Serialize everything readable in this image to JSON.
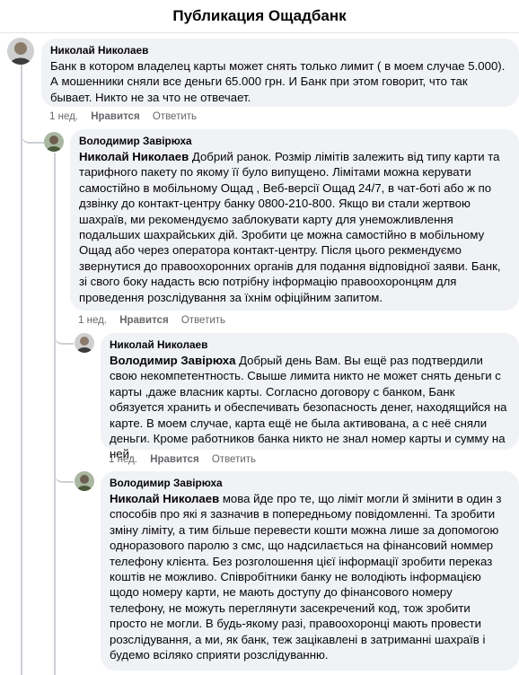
{
  "page": {
    "title": "Публикация Ощадбанк"
  },
  "comments": [
    {
      "author": "Николай Николаев",
      "mention": "",
      "text": "Банк в котором владелец карты может снять только лимит ( в моем случае 5.000). А мошенники сняли все деньги 65.000 грн. И Банк при этом говорит, что так бывает. Никто не за что не отвечает.",
      "time": "1 нед.",
      "like_label": "Нравится",
      "reply_label": "Ответить"
    },
    {
      "author": "Володимир Завірюха",
      "mention": "Николай Николаев",
      "text": " Добрий ранок. Розмір лімітів залежить від типу карти та тарифного пакету по якому її було випущено. Лімітами можна керувати самостійно в мобільному Ощад , Веб-версії Ощад 24/7, в чат-боті або ж по дзвінку до контакт-центру банку 0800-210-800. Якщо ви стали жертвою шахраїв, ми рекомендуємо заблокувати карту для унеможливлення подальших шахрайських дій. Зробити це можна самостійно в мобільному Ощад або через оператора контакт-центру. Після цього рекмендуємо звернутися до правоохоронних органів для подання відповідної заяви. Банк, зі свого боку надасть всю потрібну інформацію правоохоронцям для проведення розслідування за їхнім офіційним запитом.",
      "time": "1 нед.",
      "like_label": "Нравится",
      "reply_label": "Ответить"
    },
    {
      "author": "Николай Николаев",
      "mention": "Володимир Завірюха",
      "text": " Добрый день Вам. Вы ещё раз подтвердили свою некомпетентность. Свыше лимита никто не может снять деньги с карты ,даже власник карты. Согласно договору с банком, Банк обязуется хранить и обеспечивать безопасность денег, находящийся на карте. В моем случае, карта ещё не была активована, а с неё сняли деньги. Кроме работников банка никто не знал номер карты и сумму на ней.",
      "time": "1 нед.",
      "like_label": "Нравится",
      "reply_label": "Ответить"
    },
    {
      "author": "Володимир Завірюха",
      "mention": "Николай Николаев",
      "text": " мова йде про те, що ліміт могли й змінити в один з способів про які я зазначив в попередньому повідомленні. Та зробити зміну ліміту, а тим більше перевести кошти можна лише за допомогою одноразового паролю з смс, що надсилається на фінансовий номмер телефону клієнта. Без розголошення цієї інформації зробити переказ коштів не можливо. Співробітники банку не володіють інформацією щодо номеру карти, не мають доступу до фінансового номеру телефону, не можуть переглянути засекречений код, тож зробити просто не могли. В будь-якому разі, правоохоронці мають провести розслідування, а ми, як банк, теж зацікавлені в затриманні шахраїв і будемо всіляко сприяти розслідуванню.",
      "time": "",
      "like_label": "",
      "reply_label": ""
    }
  ],
  "colors": {
    "bubble": "#f0f2f5",
    "meta": "#65676b",
    "thread": "#ccd0d5"
  }
}
